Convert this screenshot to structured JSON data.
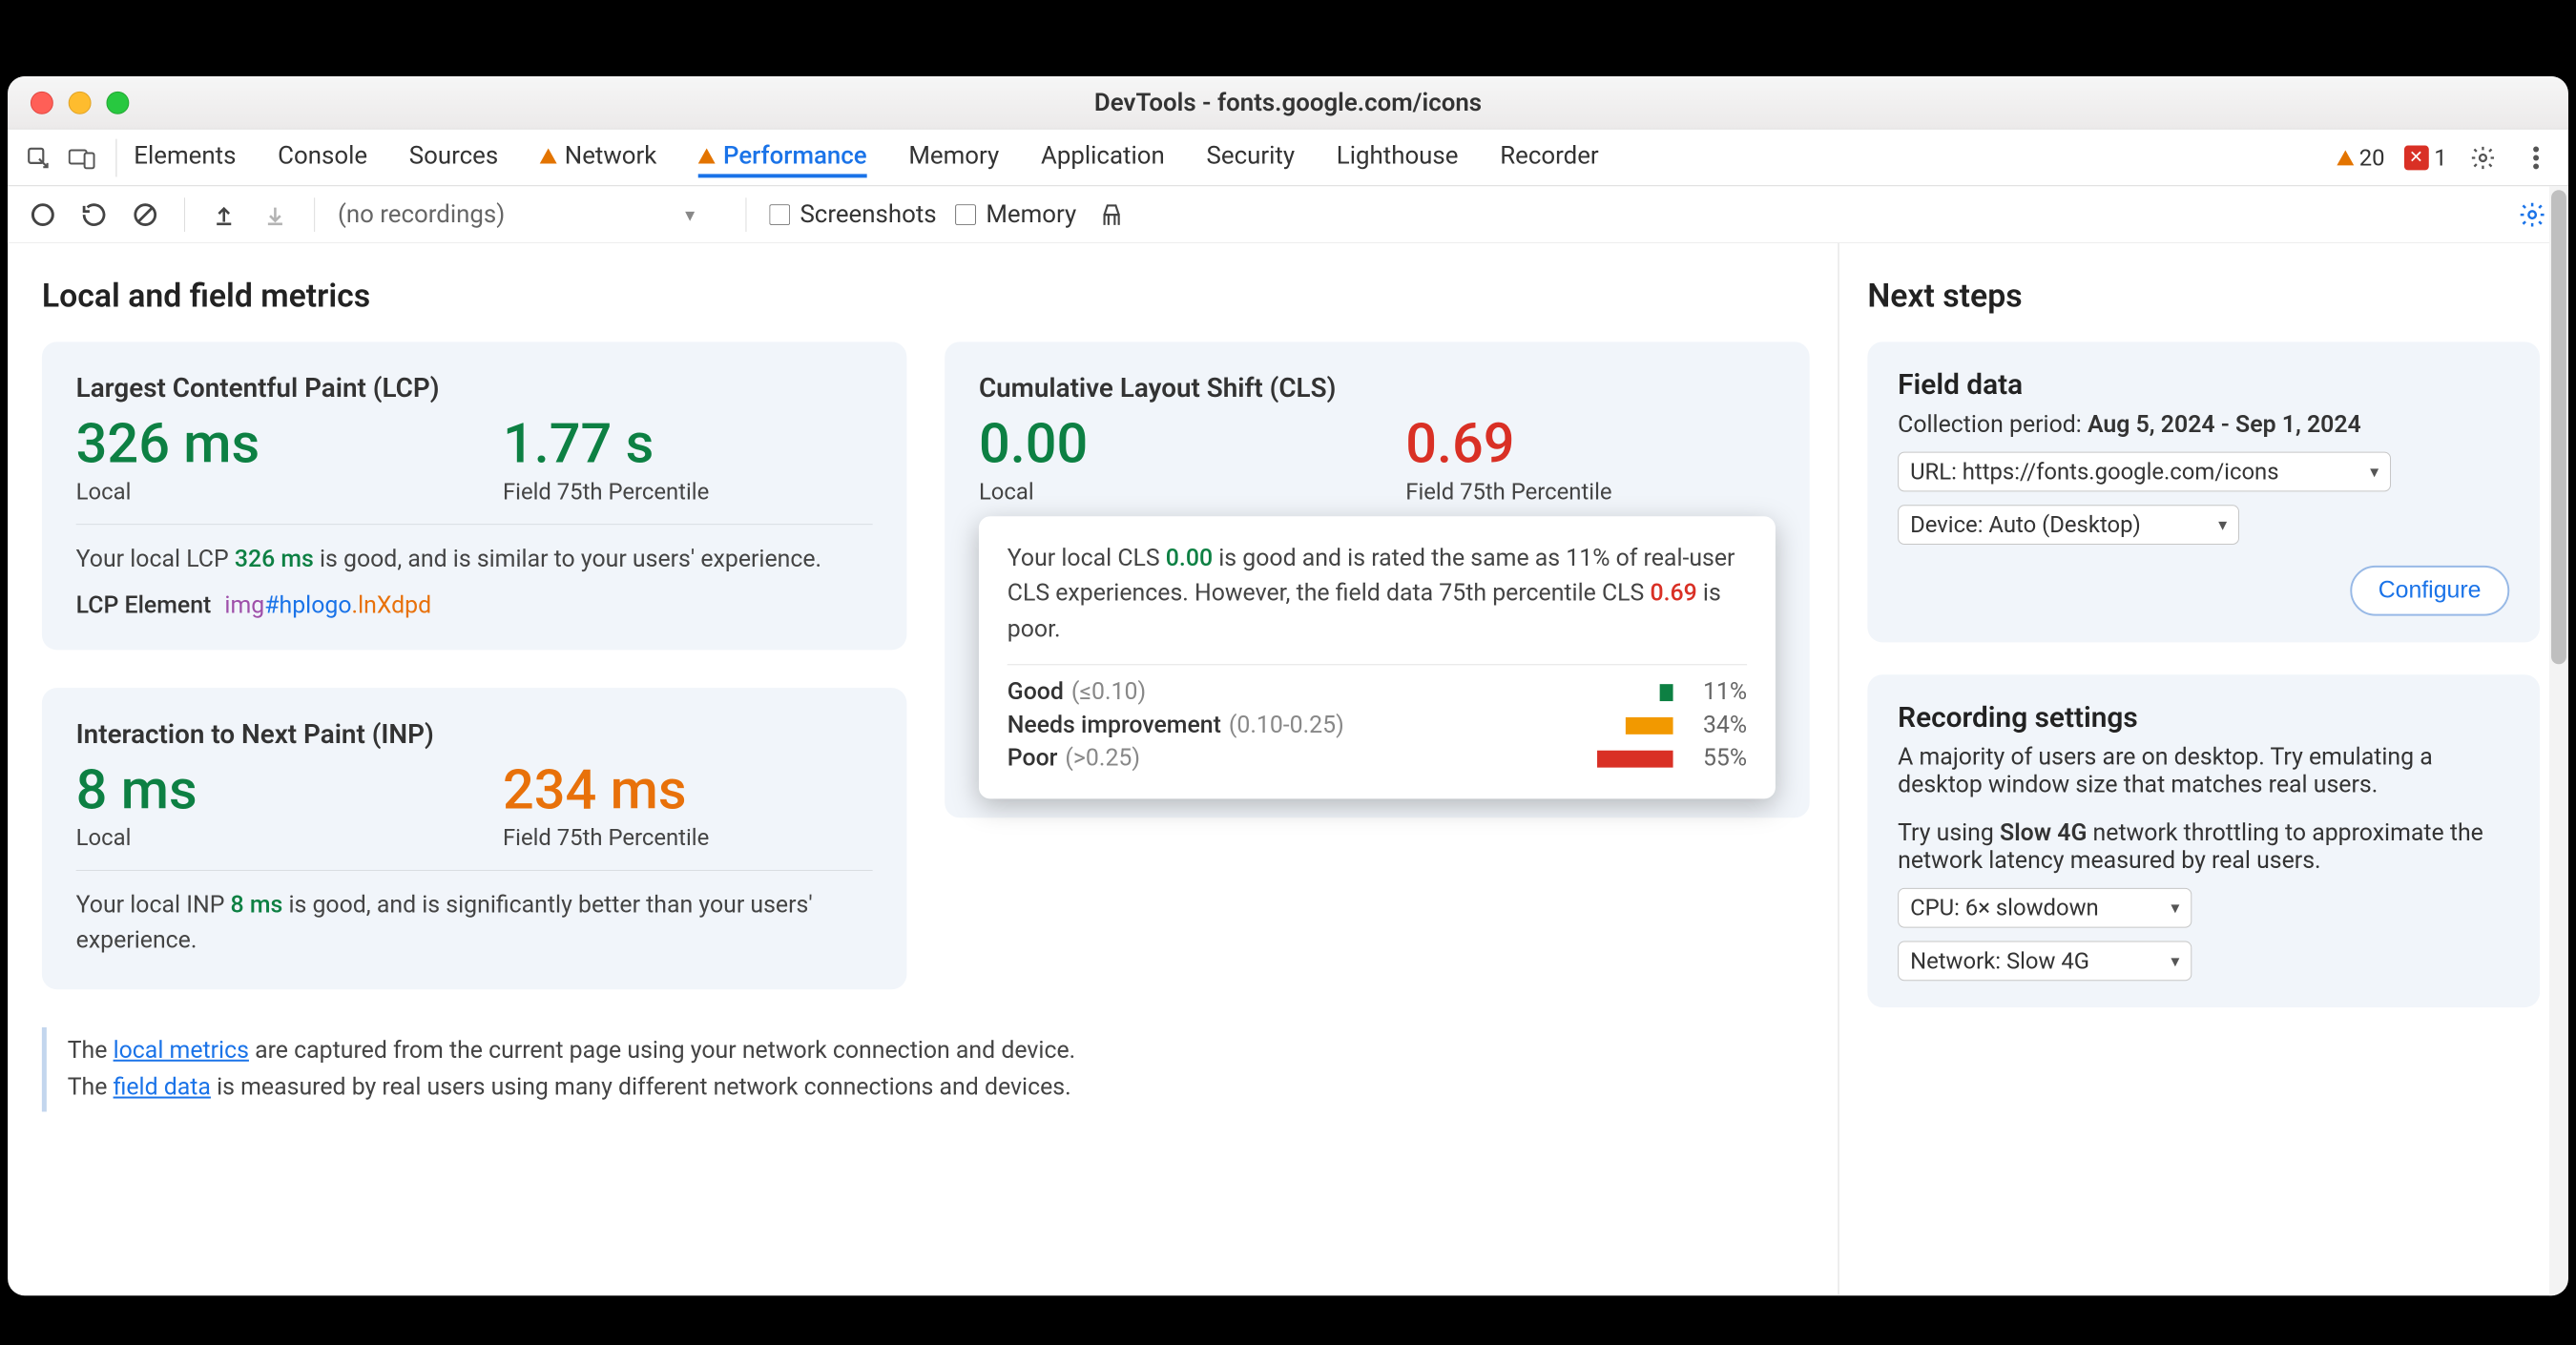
{
  "window": {
    "title": "DevTools - fonts.google.com/icons"
  },
  "tabs": {
    "items": [
      "Elements",
      "Console",
      "Sources",
      "Network",
      "Performance",
      "Memory",
      "Application",
      "Security",
      "Lighthouse",
      "Recorder"
    ],
    "active": "Performance",
    "warn_tabs": [
      "Network",
      "Performance"
    ],
    "issues_warn": "20",
    "issues_err": "1"
  },
  "toolbar": {
    "recordings_placeholder": "(no recordings)",
    "screenshots_label": "Screenshots",
    "memory_label": "Memory"
  },
  "main": {
    "heading": "Local and field metrics",
    "lcp": {
      "title": "Largest Contentful Paint (LCP)",
      "local_value": "326 ms",
      "local_label": "Local",
      "field_value": "1.77 s",
      "field_label": "Field 75th Percentile",
      "desc_pre": "Your local LCP ",
      "desc_val": "326 ms",
      "desc_post": " is good, and is similar to your users' experience.",
      "el_label": "LCP Element",
      "el_tag": "img",
      "el_id": "#hplogo",
      "el_cls": ".lnXdpd"
    },
    "inp": {
      "title": "Interaction to Next Paint (INP)",
      "local_value": "8 ms",
      "local_label": "Local",
      "field_value": "234 ms",
      "field_label": "Field 75th Percentile",
      "desc_pre": "Your local INP ",
      "desc_val": "8 ms",
      "desc_post": " is good, and is significantly better than your users' experience."
    },
    "cls": {
      "title": "Cumulative Layout Shift (CLS)",
      "local_value": "0.00",
      "local_label": "Local",
      "field_value": "0.69",
      "field_label": "Field 75th Percentile",
      "tooltip_pre": "Your local CLS ",
      "tooltip_local": "0.00",
      "tooltip_mid": " is good and is rated the same as 11% of real-user CLS experiences. However, the field data 75th percentile CLS ",
      "tooltip_field": "0.69",
      "tooltip_post": " is poor.",
      "dist": [
        {
          "label": "Good",
          "range": "(≤0.10)",
          "pct": "11%",
          "cls": "g",
          "w": 14
        },
        {
          "label": "Needs improvement",
          "range": "(0.10-0.25)",
          "pct": "34%",
          "cls": "o",
          "w": 50
        },
        {
          "label": "Poor",
          "range": "(>0.25)",
          "pct": "55%",
          "cls": "r",
          "w": 80
        }
      ]
    },
    "footer": {
      "l1a": "The ",
      "l1link": "local metrics",
      "l1b": " are captured from the current page using your network connection and device.",
      "l2a": "The ",
      "l2link": "field data",
      "l2b": " is measured by real users using many different network connections and devices."
    }
  },
  "side": {
    "heading": "Next steps",
    "field": {
      "title": "Field data",
      "period_label": "Collection period: ",
      "period_value": "Aug 5, 2024 - Sep 1, 2024",
      "url": "URL: https://fonts.google.com/icons",
      "device": "Device: Auto (Desktop)",
      "configure": "Configure"
    },
    "rec": {
      "title": "Recording settings",
      "p1": "A majority of users are on desktop. Try emulating a desktop window size that matches real users.",
      "p2a": "Try using ",
      "p2b": "Slow 4G",
      "p2c": " network throttling to approximate the network latency measured by real users.",
      "cpu": "CPU: 6× slowdown",
      "net": "Network: Slow 4G"
    }
  }
}
